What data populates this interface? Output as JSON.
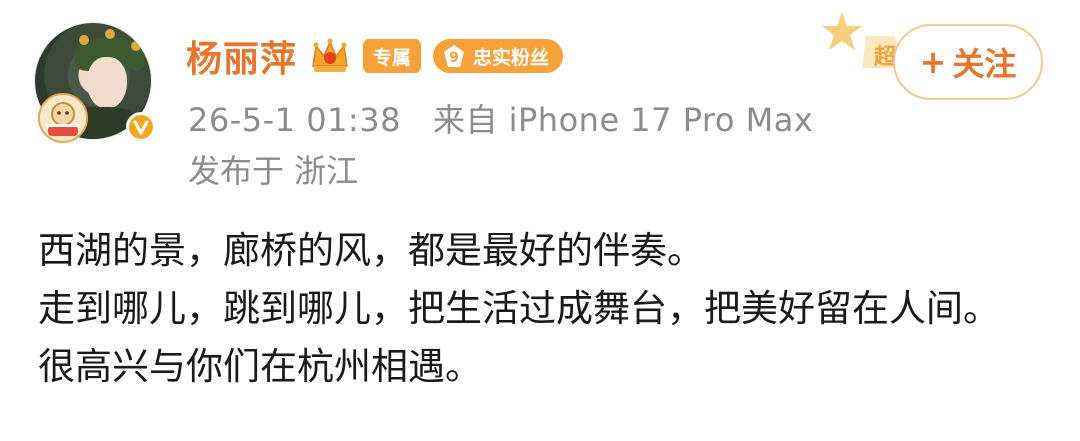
{
  "user": {
    "name": "杨丽萍",
    "badge_exclusive": "专属",
    "fan_badge_level": "9",
    "fan_badge_label": "忠实粉丝",
    "verified_color": "#f5a623"
  },
  "post_meta": {
    "timestamp": "26-5-1 01:38",
    "source": "来自 iPhone 17 Pro Max",
    "location": "发布于 浙江"
  },
  "actions": {
    "follow_label": "关注",
    "follow_icon": "+"
  },
  "content": {
    "lines": [
      "西湖的景，廊桥的风，都是最好的伴奏。",
      "走到哪儿，跳到哪儿，把生活过成舞台，把美好留在人间。",
      "很高兴与你们在杭州相遇。"
    ]
  },
  "colors": {
    "accent": "#e9742b",
    "badge": "#f6a13a",
    "meta_text": "#8c8c8c"
  }
}
